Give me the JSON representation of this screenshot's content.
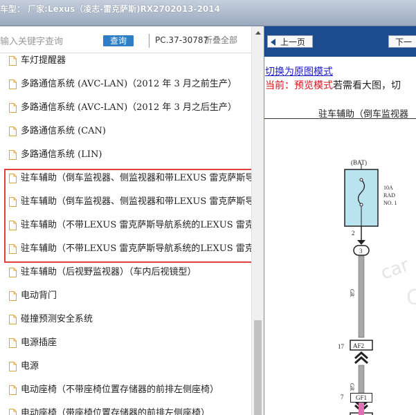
{
  "window": {
    "title": "车型：  厂家:Lexus（凌志-雷克萨斯)RX2702013-2014"
  },
  "search": {
    "placeholder": "输入关键字查询",
    "button": "查询",
    "code": "PC.37-30787",
    "collapse_all": "折叠全部"
  },
  "tree": {
    "items": [
      {
        "label": "车灯提醒器"
      },
      {
        "label": "多路通信系统 (AVC-LAN)（2012 年 3 月之前生产）"
      },
      {
        "label": "多路通信系统 (AVC-LAN)（2012 年 3 月之后生产）"
      },
      {
        "label": "多路通信系统 (CAN)"
      },
      {
        "label": "多路通信系统 (LIN)"
      },
      {
        "label": "驻车辅助（倒车监视器、侧监视器和带LEXUS 雷克萨斯导航系统）"
      },
      {
        "label": "驻车辅助（倒车监视器、侧监视器和带LEXUS 雷克萨斯导航系统）"
      },
      {
        "label": "驻车辅助（不带LEXUS 雷克萨斯导航系统的LEXUS 雷克萨斯）"
      },
      {
        "label": "驻车辅助（不带LEXUS 雷克萨斯导航系统的LEXUS 雷克萨斯）"
      },
      {
        "label": "驻车辅助（后视野监视器）（车内后视镜型）"
      },
      {
        "label": "电动背门"
      },
      {
        "label": "碰撞预测安全系统"
      },
      {
        "label": "电源插座"
      },
      {
        "label": "电源"
      },
      {
        "label": "电动座椅（不带座椅位置存储器的前排左侧座椅）"
      },
      {
        "label": "电动座椅（带座椅位置存储器的前排左侧座椅）"
      }
    ]
  },
  "viewer": {
    "prev": "上一页",
    "next": "下一",
    "switch_link": "切换为原图模式",
    "mode_prefix": "当前：",
    "mode_name": "预览模式",
    "mode_suffix": "若需看大图，切",
    "diagram_title": "驻车辅助（倒车监视器",
    "diagram": {
      "bat": "(BAT)",
      "fuse": [
        "10A",
        "RAD",
        "NO. 1"
      ],
      "pin_2": "2",
      "conn_3": "3",
      "wire_1": "GR",
      "pin_17": "17",
      "conn_af2": "AF2",
      "wire_2": "GR",
      "pin_7": "7",
      "conn_gf1": "GF1"
    },
    "watermark": "car"
  },
  "colors": {
    "highlight": "#e0403c",
    "fuse_fill": "#b9e3ee",
    "nav_bg": "#1c4c8f",
    "wire_gray": "#a8a8a8",
    "wire_pink": "#e36fb3"
  }
}
